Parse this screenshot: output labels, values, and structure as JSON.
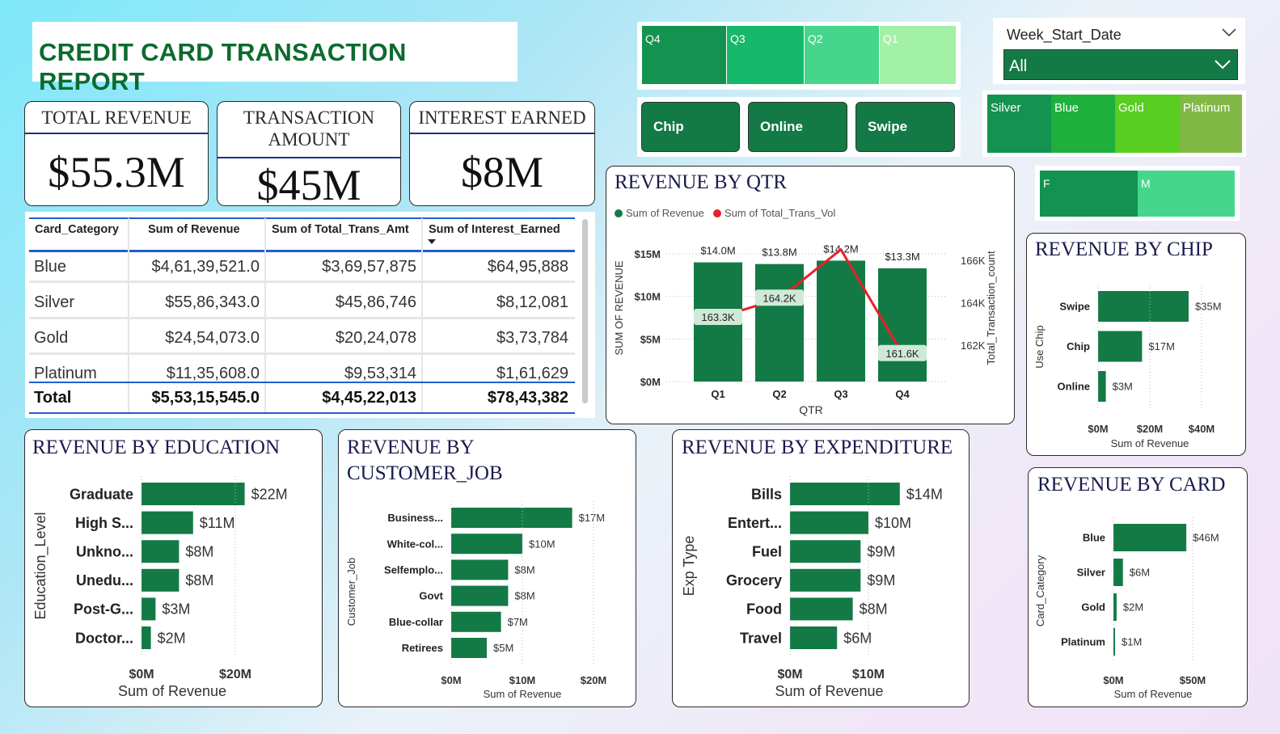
{
  "title": "CREDIT CARD TRANSACTION REPORT",
  "kpis": {
    "revenue": {
      "label": "TOTAL REVENUE",
      "value": "$55.3M"
    },
    "amount": {
      "label_line1": "TRANSACTION",
      "label_line2": "AMOUNT",
      "value": "$45M"
    },
    "interest": {
      "label": "INTEREST EARNED",
      "value": "$8M"
    }
  },
  "quarter_slicer": [
    "Q4",
    "Q3",
    "Q2",
    "Q1"
  ],
  "use_chip_buttons": [
    "Chip",
    "Online",
    "Swipe"
  ],
  "week_filter": {
    "label": "Week_Start_Date",
    "value": "All"
  },
  "card_slicer": [
    "Silver",
    "Blue",
    "Gold",
    "Platinum"
  ],
  "gender_slicer": [
    "F",
    "M"
  ],
  "table": {
    "headers": [
      "Card_Category",
      "Sum of Revenue",
      "Sum of Total_Trans_Amt",
      "Sum of Interest_Earned"
    ],
    "rows": [
      [
        "Blue",
        "$4,61,39,521.0",
        "$3,69,57,875",
        "$64,95,888"
      ],
      [
        "Silver",
        "$55,86,343.0",
        "$45,86,746",
        "$8,12,081"
      ],
      [
        "Gold",
        "$24,54,073.0",
        "$20,24,078",
        "$3,73,784"
      ],
      [
        "Platinum",
        "$11,35,608.0",
        "$9,53,314",
        "$1,61,629"
      ]
    ],
    "total": [
      "Total",
      "$5,53,15,545.0",
      "$4,45,22,013",
      "$78,43,382"
    ]
  },
  "colors": {
    "bar": "#137a45",
    "line": "#e8202a",
    "title": "#0b6b2f",
    "heading": "#1a1a4e"
  },
  "chart_data": [
    {
      "type": "bar+line",
      "title": "REVENUE BY QTR",
      "legend": [
        "Sum of Revenue",
        "Sum of Total_Trans_Vol"
      ],
      "xlabel": "QTR",
      "ylabel": "SUM OF REVENUE",
      "y2label": "Total_Transaction_count",
      "categories": [
        "Q1",
        "Q2",
        "Q3",
        "Q4"
      ],
      "bar_values": [
        14.0,
        13.8,
        14.2,
        13.3
      ],
      "bar_labels": [
        "$14.0M",
        "$13.8M",
        "$14.2M",
        "$13.3M"
      ],
      "line_values": [
        163.3,
        164.2,
        166.5,
        161.6
      ],
      "line_labels": [
        "163.3K",
        "164.2K",
        "",
        "161.6K"
      ],
      "y_ticks": [
        "$0M",
        "$5M",
        "$10M",
        "$15M"
      ],
      "y2_ticks": [
        "162K",
        "164K",
        "166K"
      ],
      "ylim": [
        0,
        15
      ],
      "y2lim": [
        160.3,
        166.3
      ]
    },
    {
      "type": "bar",
      "orientation": "horizontal",
      "title": "REVENUE BY CHIP",
      "categories": [
        "Swipe",
        "Chip",
        "Online"
      ],
      "values": [
        35,
        17,
        3
      ],
      "labels": [
        "$35M",
        "$17M",
        "$3M"
      ],
      "ylabel": "Use Chip",
      "xlabel": "Sum of Revenue",
      "x_ticks": [
        "$0M",
        "$20M",
        "$40M"
      ],
      "xlim": [
        0,
        40
      ]
    },
    {
      "type": "bar",
      "orientation": "horizontal",
      "title": "REVENUE BY EDUCATION",
      "categories": [
        "Graduate",
        "High S...",
        "Unkno...",
        "Unedu...",
        "Post-G...",
        "Doctor..."
      ],
      "values": [
        22,
        11,
        8,
        8,
        3,
        2
      ],
      "labels": [
        "$22M",
        "$11M",
        "$8M",
        "$8M",
        "$3M",
        "$2M"
      ],
      "ylabel": "Education_Level",
      "xlabel": "Sum of Revenue",
      "x_ticks": [
        "$0M",
        "$20M"
      ],
      "xlim": [
        0,
        20
      ]
    },
    {
      "type": "bar",
      "orientation": "horizontal",
      "title_line1": "REVENUE BY",
      "title_line2": "CUSTOMER_JOB",
      "categories": [
        "Business...",
        "White-col...",
        "Selfemplo...",
        "Govt",
        "Blue-collar",
        "Retirees"
      ],
      "values": [
        17,
        10,
        8,
        8,
        7,
        5
      ],
      "labels": [
        "$17M",
        "$10M",
        "$8M",
        "$8M",
        "$7M",
        "$5M"
      ],
      "ylabel": "Customer_Job",
      "xlabel": "Sum of Revenue",
      "x_ticks": [
        "$0M",
        "$10M",
        "$20M"
      ],
      "xlim": [
        0,
        20
      ]
    },
    {
      "type": "bar",
      "orientation": "horizontal",
      "title": "REVENUE BY EXPENDITURE",
      "categories": [
        "Bills",
        "Entert...",
        "Fuel",
        "Grocery",
        "Food",
        "Travel"
      ],
      "values": [
        14,
        10,
        9,
        9,
        8,
        6
      ],
      "labels": [
        "$14M",
        "$10M",
        "$9M",
        "$9M",
        "$8M",
        "$6M"
      ],
      "ylabel": "Exp Type",
      "xlabel": "Sum of Revenue",
      "x_ticks": [
        "$0M",
        "$10M"
      ],
      "xlim": [
        0,
        10
      ]
    },
    {
      "type": "bar",
      "orientation": "horizontal",
      "title": "REVENUE BY CARD",
      "categories": [
        "Blue",
        "Silver",
        "Gold",
        "Platinum"
      ],
      "values": [
        46,
        6,
        2,
        1
      ],
      "labels": [
        "$46M",
        "$6M",
        "$2M",
        "$1M"
      ],
      "ylabel": "Card_Category",
      "xlabel": "Sum of Revenue",
      "x_ticks": [
        "$0M",
        "$50M"
      ],
      "xlim": [
        0,
        50
      ]
    }
  ]
}
